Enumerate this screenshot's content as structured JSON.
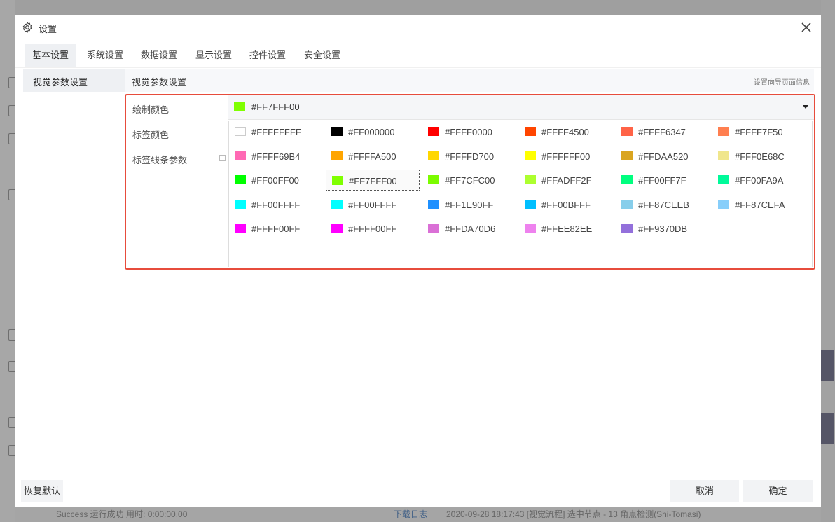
{
  "dialog": {
    "title": "设置",
    "tabs": [
      "基本设置",
      "系统设置",
      "数据设置",
      "显示设置",
      "控件设置",
      "安全设置"
    ],
    "side_menu_item": "视觉参数设置",
    "section_title": "视觉参数设置",
    "section_hint": "设置向导页面信息",
    "params": [
      "绘制颜色",
      "标签颜色",
      "标签线条参数"
    ],
    "dropdown": {
      "value": "#FF7FFF00",
      "color": "#7fff00"
    },
    "palette": [
      {
        "label": "#FFFFFFFF",
        "color": "#ffffff"
      },
      {
        "label": "#FF000000",
        "color": "#000000"
      },
      {
        "label": "#FFFF0000",
        "color": "#ff0000"
      },
      {
        "label": "#FFFF4500",
        "color": "#ff4500"
      },
      {
        "label": "#FFFF6347",
        "color": "#ff6347"
      },
      {
        "label": "#FFFF7F50",
        "color": "#ff7f50"
      },
      {
        "label": "#FFFF69B4",
        "color": "#ff69b4"
      },
      {
        "label": "#FFFFA500",
        "color": "#ffa500"
      },
      {
        "label": "#FFFFD700",
        "color": "#ffd700"
      },
      {
        "label": "#FFFFFF00",
        "color": "#ffff00"
      },
      {
        "label": "#FFDAA520",
        "color": "#daa520"
      },
      {
        "label": "#FFF0E68C",
        "color": "#f0e68c"
      },
      {
        "label": "#FF00FF00",
        "color": "#00ff00"
      },
      {
        "label": "#FF7FFF00",
        "color": "#7fff00",
        "selected": true
      },
      {
        "label": "#FF7CFC00",
        "color": "#7cfc00"
      },
      {
        "label": "#FFADFF2F",
        "color": "#adff2f"
      },
      {
        "label": "#FF00FF7F",
        "color": "#00ff7f"
      },
      {
        "label": "#FF00FA9A",
        "color": "#00fa9a"
      },
      {
        "label": "#FF00FFFF",
        "color": "#00ffff"
      },
      {
        "label": "#FF00FFFF",
        "color": "#00ffff"
      },
      {
        "label": "#FF1E90FF",
        "color": "#1e90ff"
      },
      {
        "label": "#FF00BFFF",
        "color": "#00bfff"
      },
      {
        "label": "#FF87CEEB",
        "color": "#87ceeb"
      },
      {
        "label": "#FF87CEFA",
        "color": "#87cefa"
      },
      {
        "label": "#FFFF00FF",
        "color": "#ff00ff"
      },
      {
        "label": "#FFFF00FF",
        "color": "#ff00ff"
      },
      {
        "label": "#FFDA70D6",
        "color": "#da70d6"
      },
      {
        "label": "#FFEE82EE",
        "color": "#ee82ee"
      },
      {
        "label": "#FF9370DB",
        "color": "#9370db"
      }
    ],
    "buttons": {
      "reset": "恢复默认",
      "cancel": "取消",
      "ok": "确定"
    }
  },
  "background": {
    "status_left": "Success 运行成功 用时: 0:00:00.00",
    "status_link": "下载日志",
    "status_right": "2020-09-28 18:17:43 [视觉流程] 选中节点 - 13 角点检测(Shi-Tomasi)"
  }
}
